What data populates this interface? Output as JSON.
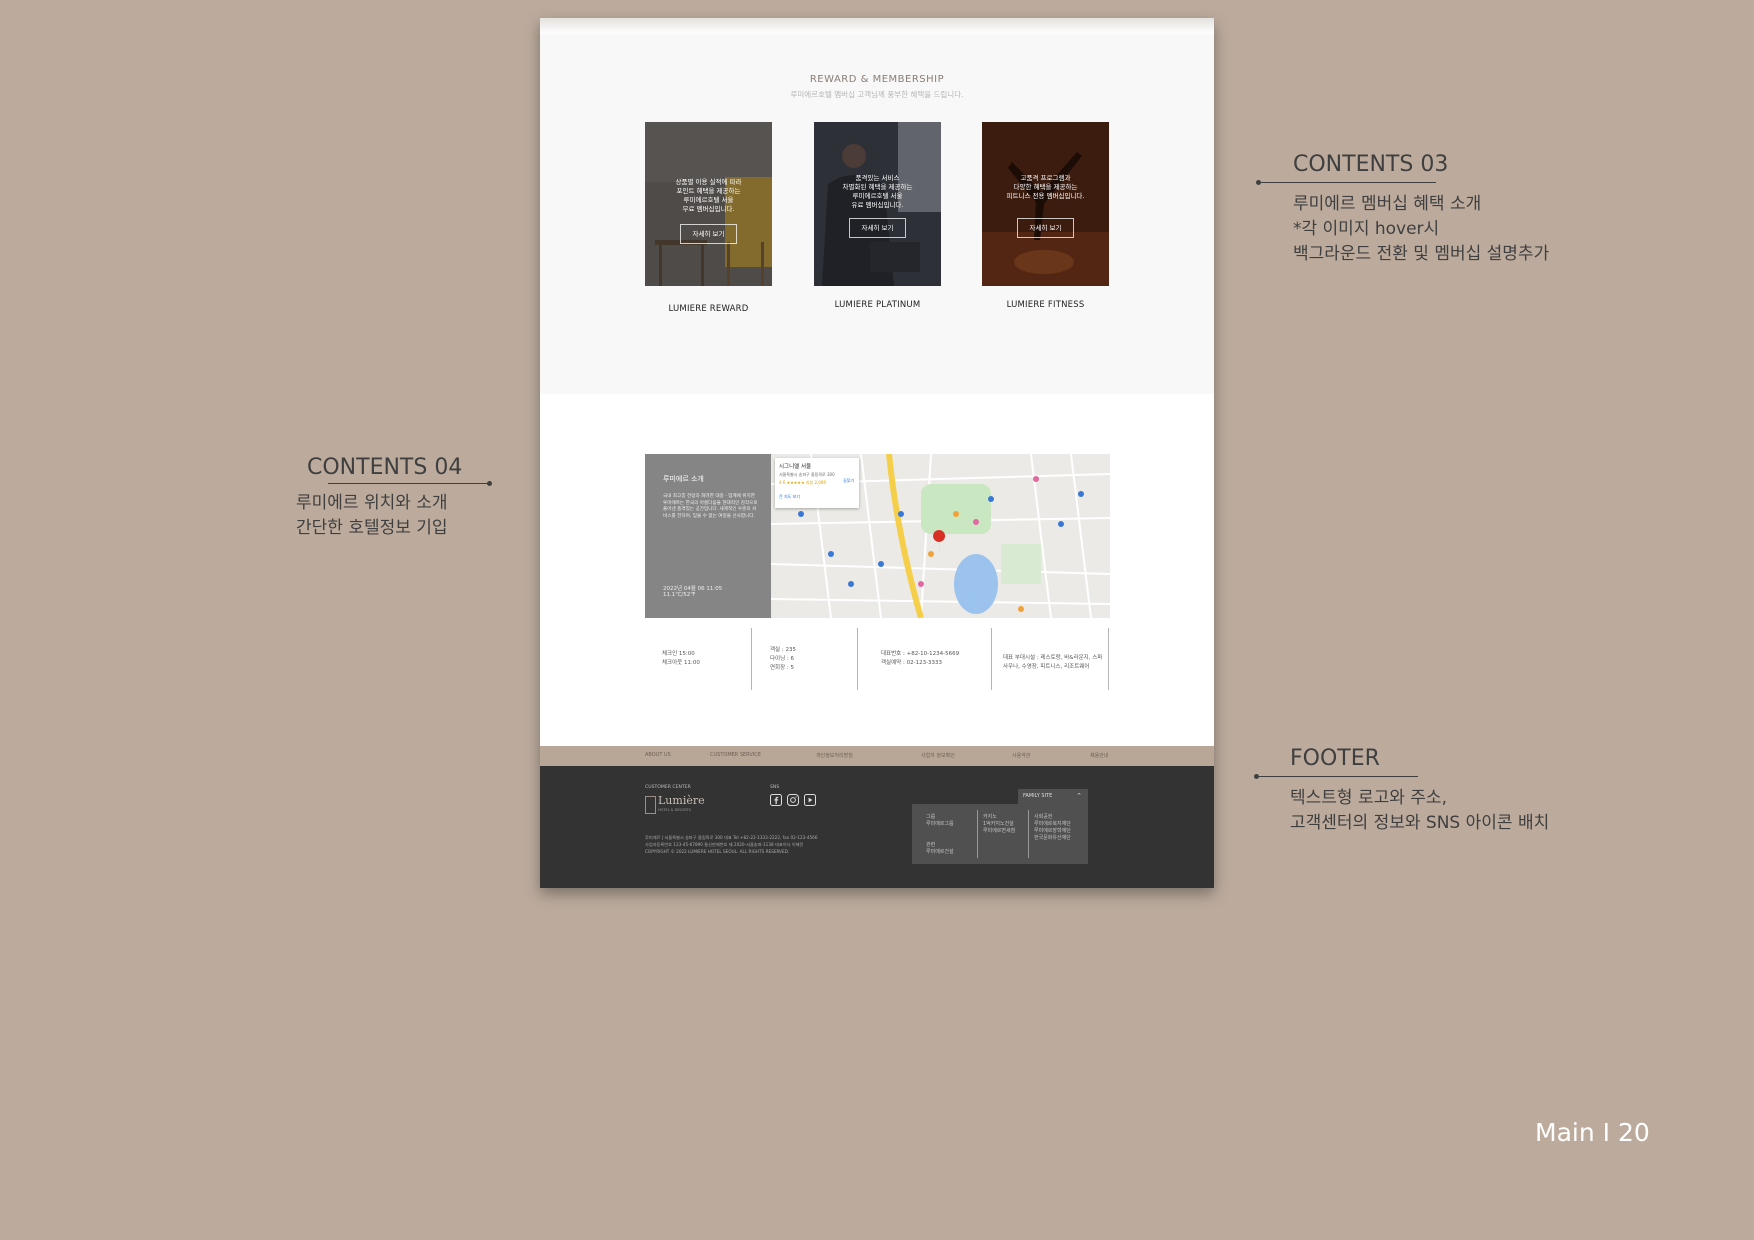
{
  "reward": {
    "title": "REWARD & MEMBERSHIP",
    "subtitle": "루미에르호텔 멤버십 고객님께 풍부한 혜택을 드립니다.",
    "cards": [
      {
        "text": "상품별 이용 실적에 따라\n포인트 혜택을 제공하는\n루미에르호텔 서울\n무료 멤버십입니다.",
        "button": "자세히 보기",
        "label": "LUMIERE REWARD"
      },
      {
        "text": "품격있는 서비스\n차별화된 혜택을 제공하는\n루미에르호텔 서울\n유료 멤버십입니다.",
        "button": "자세히 보기",
        "label": "LUMIERE PLATINUM"
      },
      {
        "text": "고품격 프로그램과\n다양한 혜택을 제공하는\n피트니스 전용 멤버십입니다.",
        "button": "자세히 보기",
        "label": "LUMIERE FITNESS"
      }
    ]
  },
  "location": {
    "panel_title": "루미에르 소개",
    "panel_desc": "국내 최고층 전망과 화려한 대중 · 업계에 위치한 루미에르는 한국의 아름다움을 현대적인 감각으로 풀어낸 품격있는 공간입니다. 세계적인 수준의 서비스를 전하며, 잊을 수 없는 여정을 선사합니다.",
    "date": "2022년 04월 06 11:05",
    "weather": "11.1℃/52℉",
    "map_card_title": "시그니엘 서울",
    "map_card_addr": "서울특별시 송파구 올림픽로 300",
    "map_card_rating": "4.6 ★★★★★ 리뷰 2,069",
    "map_card_link": "큰 지도 보기",
    "map_card_dir": "길찾기",
    "info": [
      [
        "체크인 15:00",
        "체크아웃 11:00"
      ],
      [
        "객실 : 235",
        "다이닝 : 6",
        "연회장 : 5"
      ],
      [
        "대표번호 : +82-10-1234-5669",
        "객실예약 : 02-123-3333"
      ],
      [
        "대표 부대시설 : 레스토랑, 바&라운지, 스파",
        "사우나, 수영장, 피트니스, 리조트웨어"
      ]
    ]
  },
  "footer": {
    "nav": [
      "ABOUT US",
      "CUSTOMER SERVICE",
      "개인정보처리방침",
      "사업자 정보확인",
      "사용약관",
      "채용안내"
    ],
    "customer_center": "CUSTOMER CENTER",
    "logo": "Lumière",
    "logo_sub": "HOTEL & RESORTS",
    "sns_label": "SNS",
    "sns_icons": [
      "facebook-icon",
      "instagram-icon",
      "youtube-icon"
    ],
    "address": "루미에르 | 서울특별시 송파구 올림픽로 300 대표 Tel +82-22-1333-2222, fax 02-123-4566",
    "business": "사업자등록번호 123-45-67890 통신판매번호 제 2020-서울송파-1138 대표이사 이해민",
    "copyright": "COPYRIGHT © 2022 LUMIERE HOTEL SEOUL. ALL RIGHTS RESERVED.",
    "family_site": "FAMILY SITE",
    "family_cols": [
      [
        "그룹",
        "루미에르그룹",
        "",
        "",
        "관련",
        "루미에르건설"
      ],
      [
        "카지노",
        "1억카지노건설",
        "루미에르면세점"
      ],
      [
        "사회공헌",
        "루미에르복지재단",
        "루미에르장학재단",
        "한국문화유산재단"
      ]
    ]
  },
  "annotations": {
    "c3_title": "CONTENTS 03",
    "c3_lines": [
      "루미에르 멤버십 혜택 소개",
      "*각 이미지 hover시",
      "백그라운드 전환 및 멤버십 설명추가"
    ],
    "c4_title": "CONTENTS 04",
    "c4_lines": [
      "루미에르 위치와 소개",
      "간단한 호텔정보 기입"
    ],
    "footer_title": "FOOTER",
    "footer_lines": [
      "텍스트형 로고와 주소,",
      "고객센터의 정보와 SNS 아이콘 배치"
    ],
    "page_number": "Main I 20"
  }
}
